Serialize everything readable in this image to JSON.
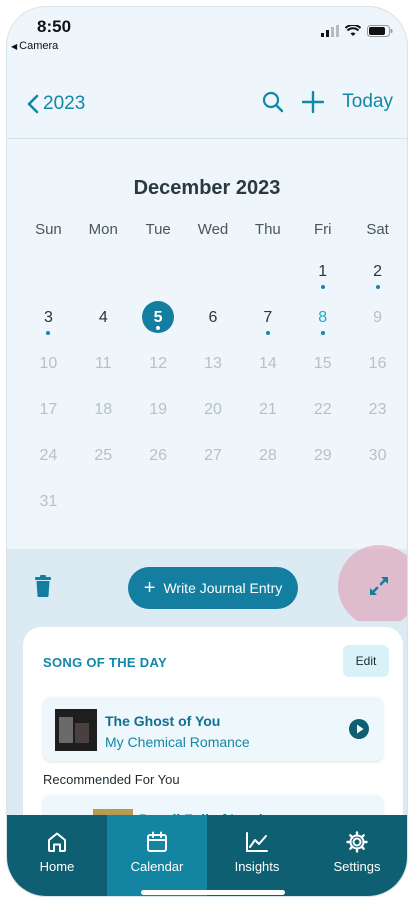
{
  "status_bar": {
    "time": "8:50",
    "back_app": "Camera"
  },
  "header": {
    "back_label": "2023",
    "today_label": "Today"
  },
  "calendar": {
    "month_title": "December 2023",
    "weekdays": [
      "Sun",
      "Mon",
      "Tue",
      "Wed",
      "Thu",
      "Fri",
      "Sat"
    ],
    "days": [
      "",
      "",
      "",
      "",
      "",
      "1",
      "2",
      "3",
      "4",
      "5",
      "6",
      "7",
      "8",
      "9",
      "10",
      "11",
      "12",
      "13",
      "14",
      "15",
      "16",
      "17",
      "18",
      "19",
      "20",
      "21",
      "22",
      "23",
      "24",
      "25",
      "26",
      "27",
      "28",
      "29",
      "30",
      "31"
    ],
    "selected_day": "5",
    "accent_day": "8",
    "dot_days": [
      "1",
      "2",
      "3",
      "5",
      "7",
      "8"
    ],
    "faded_from": 9
  },
  "actions": {
    "write_label": "Write Journal Entry"
  },
  "song_of_day": {
    "title": "SONG OF THE DAY",
    "edit_label": "Edit",
    "song_title": "The Ghost of You",
    "song_artist": "My Chemical Romance",
    "recommended_label": "Recommended For You",
    "rec_song_title": "Pencil Full of Lead"
  },
  "tabs": [
    {
      "label": "Home",
      "icon": "home-icon"
    },
    {
      "label": "Calendar",
      "icon": "calendar-icon"
    },
    {
      "label": "Insights",
      "icon": "chart-icon"
    },
    {
      "label": "Settings",
      "icon": "gear-icon"
    }
  ],
  "colors": {
    "accent": "#1287a8",
    "tab_bar": "#0f5f72",
    "tab_active": "#1385a3"
  }
}
